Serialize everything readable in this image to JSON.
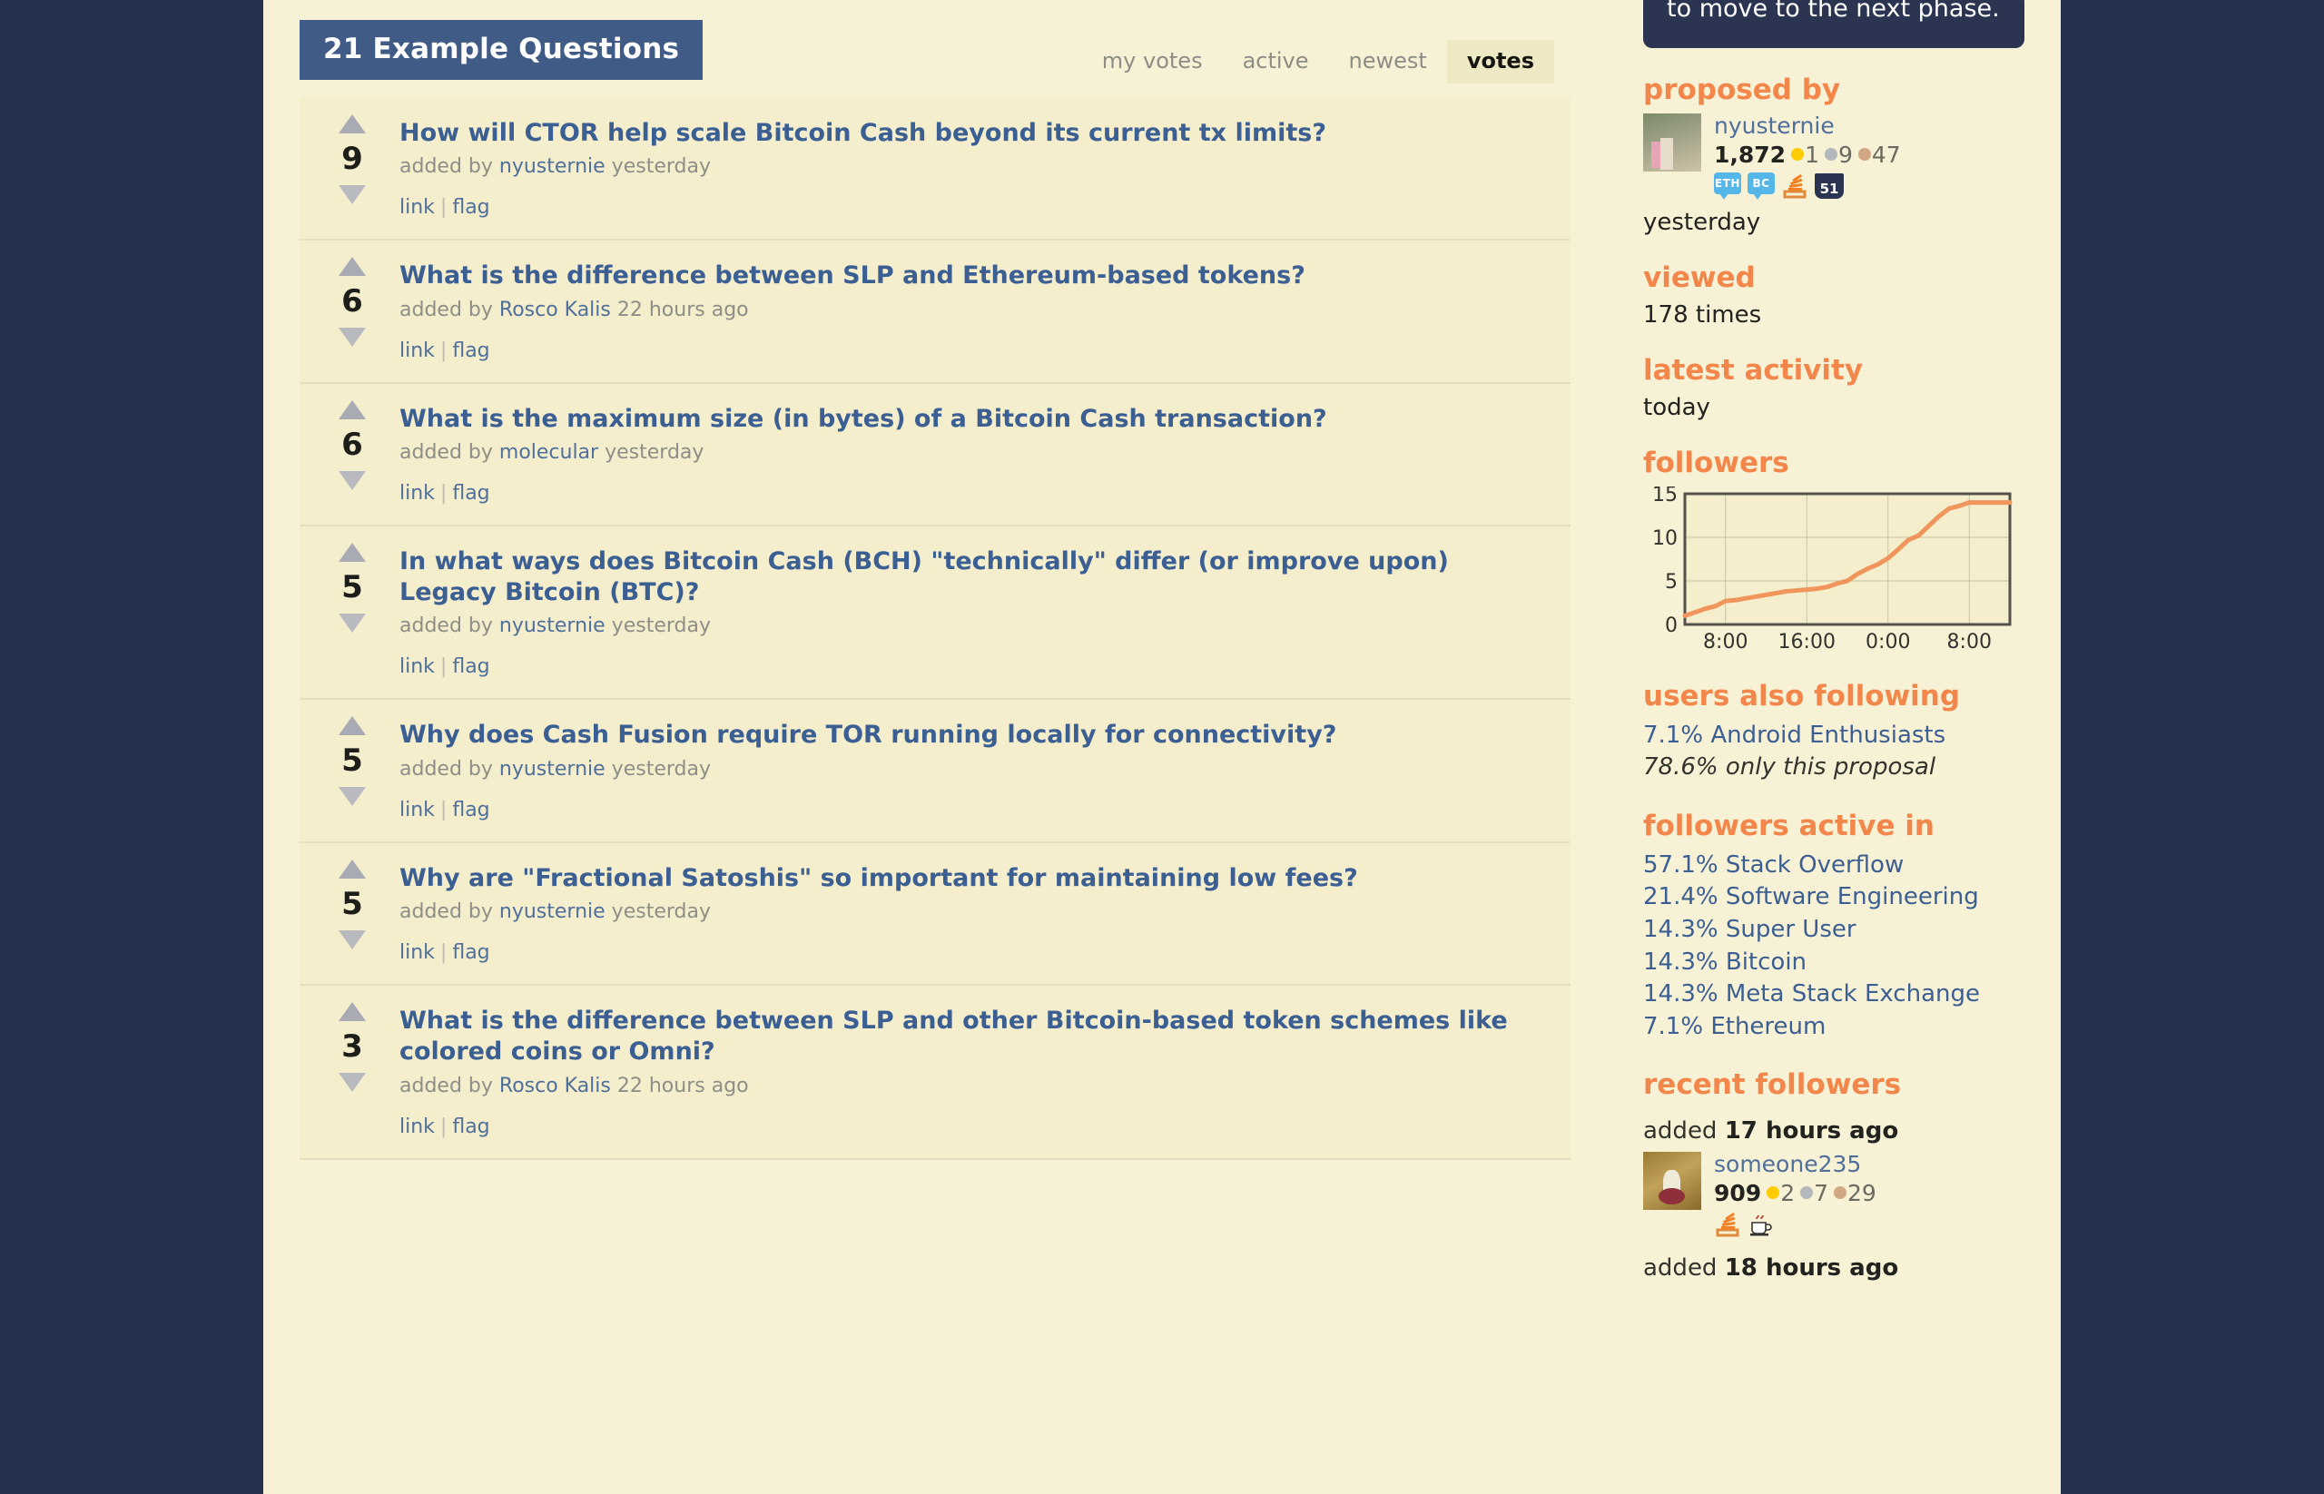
{
  "header": {
    "title_tab": "21 Example Questions",
    "tabs": [
      {
        "label": "my votes",
        "selected": false
      },
      {
        "label": "active",
        "selected": false
      },
      {
        "label": "newest",
        "selected": false
      },
      {
        "label": "votes",
        "selected": true
      }
    ]
  },
  "questions": [
    {
      "score": "9",
      "title": "How will CTOR help scale Bitcoin Cash beyond its current tx limits?",
      "added_by_label": "added by",
      "user": "nyusternie",
      "time": "yesterday",
      "link_label": "link",
      "flag_label": "flag"
    },
    {
      "score": "6",
      "title": "What is the difference between SLP and Ethereum-based tokens?",
      "added_by_label": "added by",
      "user": "Rosco Kalis",
      "time": "22 hours ago",
      "link_label": "link",
      "flag_label": "flag"
    },
    {
      "score": "6",
      "title": "What is the maximum size (in bytes) of a Bitcoin Cash transaction?",
      "added_by_label": "added by",
      "user": "molecular",
      "time": "yesterday",
      "link_label": "link",
      "flag_label": "flag"
    },
    {
      "score": "5",
      "title": "In what ways does Bitcoin Cash (BCH) \"technically\" differ (or improve upon) Legacy Bitcoin (BTC)?",
      "added_by_label": "added by",
      "user": "nyusternie",
      "time": "yesterday",
      "link_label": "link",
      "flag_label": "flag"
    },
    {
      "score": "5",
      "title": "Why does Cash Fusion require TOR running locally for connectivity?",
      "added_by_label": "added by",
      "user": "nyusternie",
      "time": "yesterday",
      "link_label": "link",
      "flag_label": "flag"
    },
    {
      "score": "5",
      "title": "Why are \"Fractional Satoshis\" so important for maintaining low fees?",
      "added_by_label": "added by",
      "user": "nyusternie",
      "time": "yesterday",
      "link_label": "link",
      "flag_label": "flag"
    },
    {
      "score": "3",
      "title": "What is the difference between SLP and other Bitcoin-based token schemes like colored coins or Omni?",
      "added_by_label": "added by",
      "user": "Rosco Kalis",
      "time": "22 hours ago",
      "link_label": "link",
      "flag_label": "flag"
    }
  ],
  "sidebar": {
    "callout_text": "to move to the next phase.",
    "proposed_by": {
      "heading": "proposed by",
      "user": "nyusternie",
      "reputation": "1,872",
      "gold": "1",
      "silver": "9",
      "bronze": "47",
      "site_badges": [
        "ETH",
        "BC",
        "stack-overflow",
        "51"
      ],
      "time": "yesterday"
    },
    "viewed": {
      "heading": "viewed",
      "value": "178 times"
    },
    "latest_activity": {
      "heading": "latest activity",
      "value": "today"
    },
    "followers": {
      "heading": "followers"
    },
    "users_also_following": {
      "heading": "users also following",
      "items": [
        {
          "pct": "7.1%",
          "name": "Android Enthusiasts",
          "italic": false
        },
        {
          "pct": "78.6%",
          "name": "only this proposal",
          "italic": true
        }
      ]
    },
    "followers_active_in": {
      "heading": "followers active in",
      "items": [
        {
          "pct": "57.1%",
          "name": "Stack Overflow"
        },
        {
          "pct": "21.4%",
          "name": "Software Engineering"
        },
        {
          "pct": "14.3%",
          "name": "Super User"
        },
        {
          "pct": "14.3%",
          "name": "Bitcoin"
        },
        {
          "pct": "14.3%",
          "name": "Meta Stack Exchange"
        },
        {
          "pct": "7.1%",
          "name": "Ethereum"
        }
      ]
    },
    "recent_followers": {
      "heading": "recent followers",
      "entries": [
        {
          "added_label": "added",
          "added_time": "17 hours ago",
          "user": "someone235",
          "reputation": "909",
          "gold": "2",
          "silver": "7",
          "bronze": "29",
          "site_badges": [
            "stack-overflow",
            "coffee"
          ]
        },
        {
          "added_label": "added",
          "added_time": "18 hours ago"
        }
      ]
    }
  },
  "colors": {
    "outer_bg": "#26314f",
    "page_bg": "#f7f1d5",
    "row_bg": "#f4eecd",
    "accent_orange": "#f3864a",
    "link_blue": "#3c5f93",
    "tab_blue": "#3f5b86",
    "chart_line": "#f0955c"
  },
  "chart_data": {
    "type": "line",
    "title": "followers",
    "xlabel": "",
    "ylabel": "",
    "ylim": [
      0,
      15
    ],
    "yticks": [
      0,
      5,
      10,
      15
    ],
    "xticks": [
      "8:00",
      "16:00",
      "0:00",
      "8:00"
    ],
    "grid": true,
    "legend": "none",
    "x": [
      0,
      1,
      2,
      3,
      4,
      5,
      6,
      7,
      8,
      9,
      10,
      11,
      12,
      13,
      14,
      15,
      16,
      17,
      18,
      19,
      20,
      21,
      22,
      23,
      24,
      25,
      26,
      27,
      28,
      29,
      30,
      31,
      32
    ],
    "values": [
      1,
      1.4,
      1.8,
      2.1,
      2.7,
      2.8,
      3.0,
      3.2,
      3.4,
      3.6,
      3.8,
      3.9,
      4.0,
      4.1,
      4.3,
      4.7,
      5.0,
      5.8,
      6.4,
      6.9,
      7.6,
      8.6,
      9.7,
      10.2,
      11.3,
      12.4,
      13.3,
      13.6,
      14.0,
      14.0,
      14.0,
      14.0,
      14.0
    ]
  }
}
